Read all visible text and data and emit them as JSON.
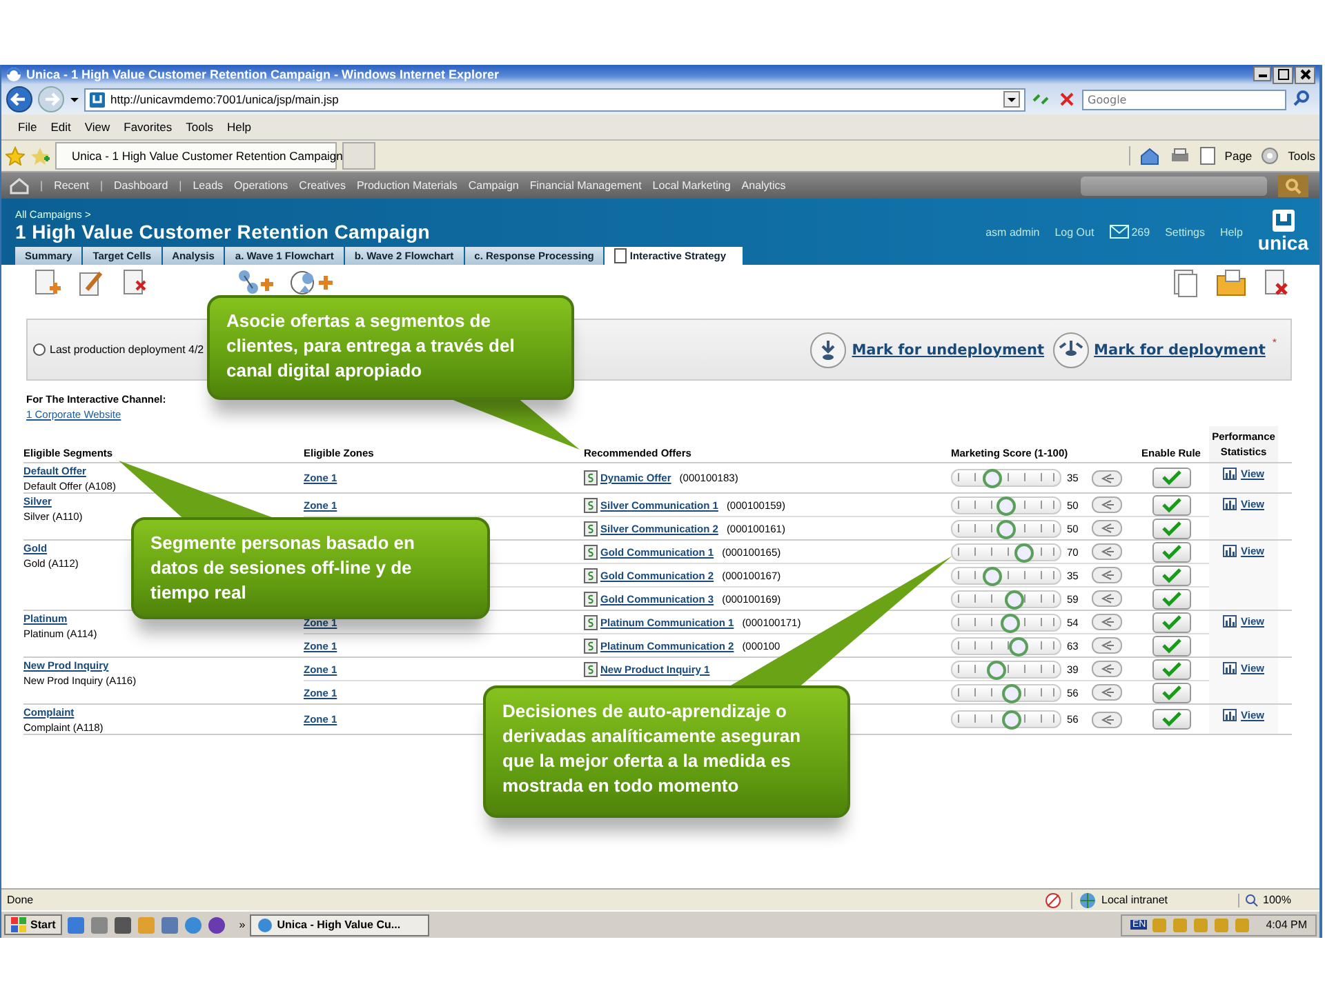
{
  "window": {
    "title": "Unica - 1 High Value Customer Retention Campaign - Windows Internet Explorer"
  },
  "address_bar": {
    "url": "http://unicavmdemo:7001/unica/jsp/main.jsp",
    "search_placeholder": "Google"
  },
  "menu": [
    "File",
    "Edit",
    "View",
    "Favorites",
    "Tools",
    "Help"
  ],
  "browser_tab": {
    "title": "Unica - 1 High Value Customer Retention Campaign"
  },
  "command_bar": [
    "Page",
    "Tools"
  ],
  "nav_separator": "|",
  "app_nav": [
    "Recent",
    "Dashboard",
    "Leads",
    "Operations",
    "Creatives",
    "Production Materials",
    "Campaign",
    "Financial Management",
    "Local Marketing",
    "Analytics"
  ],
  "header": {
    "breadcrumb": "All Campaigns >",
    "title": "1 High Value Customer Retention Campaign",
    "user": "asm admin",
    "logout": "Log Out",
    "messages": "269",
    "settings": "Settings",
    "help": "Help",
    "logo": "unica"
  },
  "tabs": [
    {
      "label": "Summary",
      "selected": false
    },
    {
      "label": "Target Cells",
      "selected": false
    },
    {
      "label": "Analysis",
      "selected": false
    },
    {
      "label": "a. Wave 1 Flowchart",
      "selected": false
    },
    {
      "label": "b. Wave 2 Flowchart",
      "selected": false
    },
    {
      "label": "c. Response Processing",
      "selected": false
    },
    {
      "label": "Interactive Strategy",
      "selected": true
    }
  ],
  "deployment": {
    "status": "Last production deployment 4/2",
    "selected": false,
    "undeploy": "Mark for undeployment",
    "deploy": "Mark for deployment",
    "required_mark": "*"
  },
  "channel": {
    "label": "For The Interactive Channel:",
    "link": "1 Corporate Website"
  },
  "table": {
    "columns": [
      "Eligible Segments",
      "Eligible Zones",
      "Recommended Offers",
      "Marketing Score (1-100)",
      "Enable Rule",
      "Performance Statistics"
    ],
    "segments": [
      {
        "name": "Default Offer",
        "code": "Default Offer (A108)",
        "view": "View",
        "offers": [
          {
            "zone": "Zone 1",
            "name": "Dynamic Offer",
            "id": "(000100183)",
            "level": 0.35,
            "score": "35",
            "enabled": true
          }
        ]
      },
      {
        "name": "Silver",
        "code": "Silver (A110)",
        "view": "View",
        "offers": [
          {
            "zone": "Zone 1",
            "name": "Silver Communication 1",
            "id": "(000100159)",
            "level": 0.5,
            "score": "50",
            "enabled": true
          },
          {
            "name": "Silver Communication 2",
            "id": "(000100161)",
            "level": 0.5,
            "score": "50",
            "enabled": true
          }
        ]
      },
      {
        "name": "Gold",
        "code": "Gold (A112)",
        "view": "View",
        "offers": [
          {
            "name": "Gold Communication 1",
            "id": "(000100165)",
            "level": 0.7,
            "score": "70",
            "enabled": true
          },
          {
            "name": "Gold Communication 2",
            "id": "(000100167)",
            "level": 0.35,
            "score": "35",
            "enabled": true
          },
          {
            "name": "Gold Communication 3",
            "id": "(000100169)",
            "level": 0.59,
            "score": "59",
            "enabled": true
          }
        ]
      },
      {
        "name": "Platinum",
        "code": "Platinum (A114)",
        "view": "View",
        "offers": [
          {
            "zone": "Zone 1",
            "name": "Platinum Communication 1",
            "id": "(000100171)",
            "level": 0.54,
            "score": "54",
            "enabled": true
          },
          {
            "zone": "Zone 1",
            "name": "Platinum Communication 2",
            "id": "(000100",
            "level": 0.63,
            "score": "63",
            "enabled": true
          }
        ]
      },
      {
        "name": "New Prod Inquiry",
        "code": "New Prod Inquiry (A116)",
        "view": "View",
        "offers": [
          {
            "zone": "Zone 1",
            "name": "New Product Inquiry 1",
            "level": 0.39,
            "score": "39",
            "enabled": true
          },
          {
            "zone": "Zone 1",
            "level": 0.56,
            "score": "56",
            "enabled": true
          }
        ]
      },
      {
        "name": "Complaint",
        "code": "Complaint (A118)",
        "view": "View",
        "offers": [
          {
            "zone": "Zone 1",
            "level": 0.56,
            "score": "56",
            "enabled": true
          }
        ]
      }
    ]
  },
  "callouts": [
    "Asocie ofertas a segmentos de clientes, para entrega a través del canal digital apropiado",
    "Segmente personas basado en datos de sesiones off-line y de tiempo real",
    "Decisiones de auto-aprendizaje o derivadas analíticamente aseguran que la mejor oferta a la medida es mostrada en todo momento"
  ],
  "status_bar": {
    "text": "Done",
    "zone": "Local intranet",
    "zoom": "100%"
  },
  "taskbar": {
    "start": "Start",
    "more": "»",
    "task": "Unica - High Value Cu...",
    "language": "EN",
    "clock": "4:04 PM"
  }
}
